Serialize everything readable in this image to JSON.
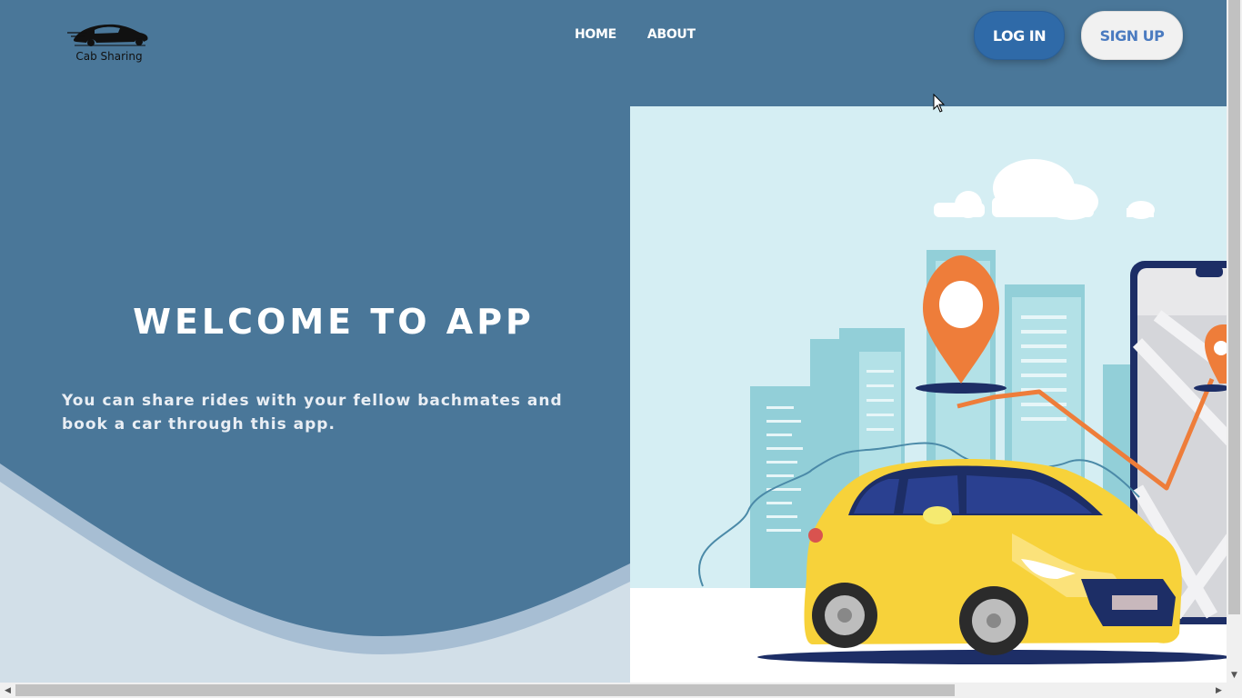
{
  "brand": {
    "logo_text": "Cab Sharing"
  },
  "nav": {
    "items": [
      {
        "label": "HOME"
      },
      {
        "label": "ABOUT"
      }
    ]
  },
  "auth": {
    "login_label": "LOG IN",
    "signup_label": "SIGN UP"
  },
  "hero": {
    "title": "WELCOME TO APP",
    "subtitle": "You can share rides with your fellow bachmates and book a car through this app."
  },
  "colors": {
    "background": "#4a7799",
    "login_button": "#2f6aa8",
    "signup_button": "#f1f1f1",
    "signup_text": "#4b7bc0",
    "car": "#f7d23a",
    "pin": "#ee7d3a"
  },
  "icons": {
    "logo": "car-logo-icon",
    "location_pin": "location-pin-icon",
    "cursor": "mouse-pointer-icon"
  }
}
